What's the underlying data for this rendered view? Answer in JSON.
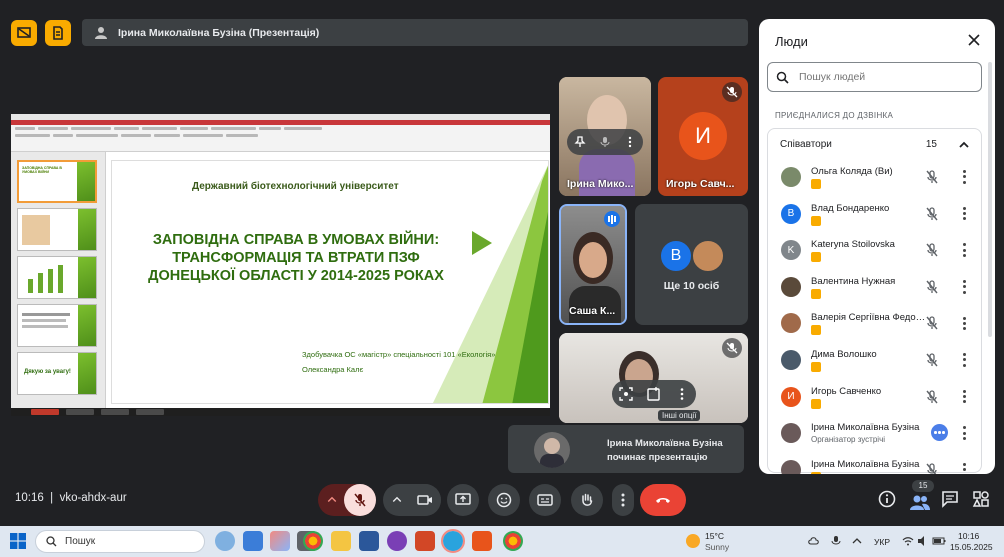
{
  "presentation_banner": {
    "text": "Ірина Миколаївна Бузіна (Презентація)"
  },
  "slide": {
    "university": "Державний біотехнологічний університет",
    "title": "ЗАПОВІДНА СПРАВА В УМОВАХ ВІЙНИ: ТРАНСФОРМАЦІЯ ТА ВТРАТИ ПЗФ ДОНЕЦЬКОЇ ОБЛАСТІ У 2014-2025 РОКАХ",
    "author_line1": "Здобувачка ОС «магістр» спеціальності 101 «Екологія»",
    "author_line2": "Олександра Калє",
    "thumb_last": "Дякую за увагу!"
  },
  "tiles": {
    "t1_name": "Ірина Мико...",
    "t2_name": "Игорь Савч...",
    "t2_initial": "И",
    "t3_name": "Саша К...",
    "t4_initial": "B",
    "t4_text": "Ще 10 осіб",
    "t5_tooltip": "Інші опції"
  },
  "toast": {
    "line1": "Ірина Миколаївна Бузіна",
    "line2": "починає презентацію"
  },
  "people_panel": {
    "title": "Люди",
    "search_placeholder": "Пошук людей",
    "joined_label": "ПРИЄДНАЛИСЯ ДО ДЗВІНКА",
    "group_label": "Співавтори",
    "group_count": "15",
    "participants": [
      {
        "name": "Ольга Коляда (Ви)",
        "initial": "",
        "color": "#7a8a6a"
      },
      {
        "name": "Влад Бондаренко",
        "initial": "B",
        "color": "#1a73e8"
      },
      {
        "name": "Kateryna Stoilovska",
        "initial": "K",
        "color": "#80868b"
      },
      {
        "name": "Валентина Нужная",
        "initial": "",
        "color": "#5a4a3a"
      },
      {
        "name": "Валерія Сергіївна Федорова",
        "initial": "",
        "color": "#a06a4a"
      },
      {
        "name": "Дима Волошко",
        "initial": "",
        "color": "#4a5a6a"
      },
      {
        "name": "Игорь Савченко",
        "initial": "И",
        "color": "#e8541b"
      },
      {
        "name": "Ірина Миколаївна Бузіна",
        "initial": "",
        "color": "#6a5a5a",
        "subtitle": "Організатор зустрічі"
      },
      {
        "name": "Ірина Миколаївна Бузіна",
        "initial": "",
        "color": "#6a5a5a"
      }
    ]
  },
  "bottom": {
    "time": "10:16",
    "code": "vko-ahdx-aur",
    "people_count": "15"
  },
  "taskbar": {
    "search": "Пошук",
    "weather_temp": "15°C",
    "weather_desc": "Sunny",
    "lang": "УКР",
    "time": "10:16",
    "date": "15.05.2025"
  },
  "colors": {
    "accent": "#f9ab00",
    "end_call": "#ea4335",
    "bg": "#202124"
  }
}
